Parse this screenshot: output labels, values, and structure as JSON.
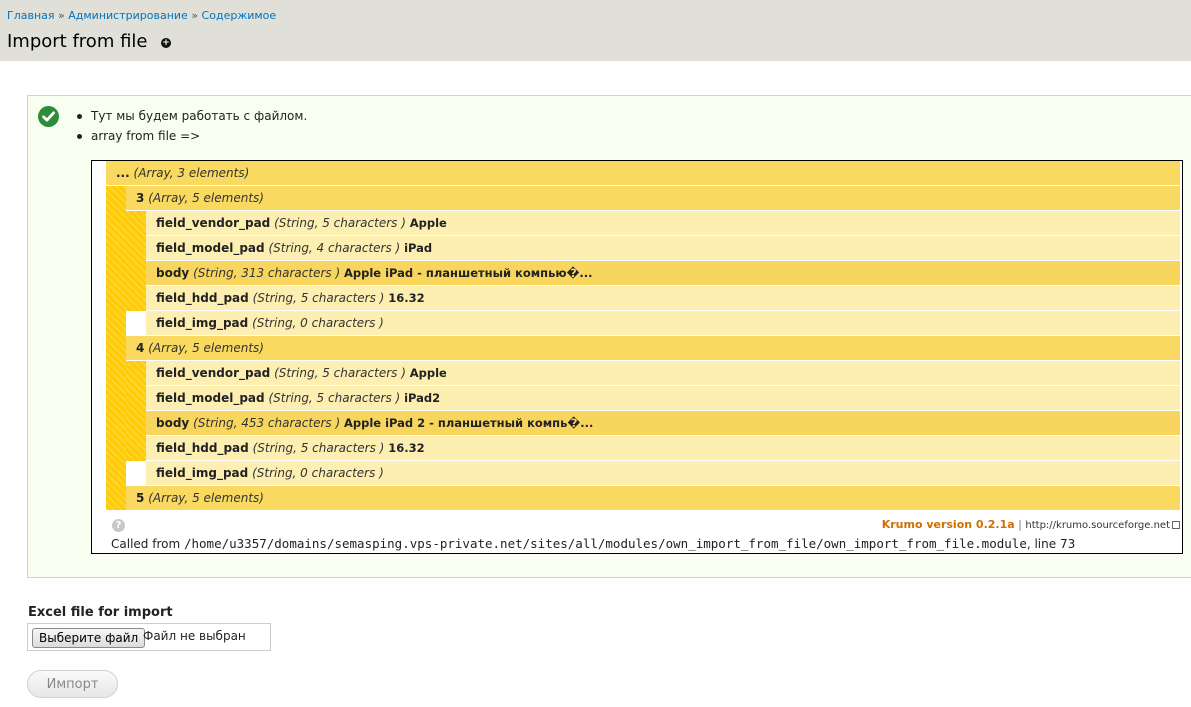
{
  "breadcrumb": {
    "items": [
      "Главная",
      "Администрирование",
      "Содержимое"
    ],
    "separator": "»"
  },
  "page": {
    "title": "Import from file",
    "shortcut_icon": "plus-circle-icon"
  },
  "messages": {
    "status_icon": "check-circle-icon",
    "items": [
      "Тут мы будем работать с файлом.",
      "array from file =>"
    ]
  },
  "krumo": {
    "root": {
      "name": "...",
      "type": "(Array, 3 elements)"
    },
    "groups": [
      {
        "name": "3",
        "type": "(Array, 5 elements)",
        "fields": [
          {
            "name": "field_vendor_pad",
            "type": "(String, 5 characters )",
            "value": "Apple"
          },
          {
            "name": "field_model_pad",
            "type": "(String, 4 characters )",
            "value": "iPad"
          },
          {
            "name": "body",
            "type": "(String, 313 characters )",
            "value": "Apple iPad - планшетный компью�..."
          },
          {
            "name": "field_hdd_pad",
            "type": "(String, 5 characters )",
            "value": "16.32"
          },
          {
            "name": "field_img_pad",
            "type": "(String, 0 characters )",
            "value": ""
          }
        ]
      },
      {
        "name": "4",
        "type": "(Array, 5 elements)",
        "fields": [
          {
            "name": "field_vendor_pad",
            "type": "(String, 5 characters )",
            "value": "Apple"
          },
          {
            "name": "field_model_pad",
            "type": "(String, 5 characters )",
            "value": "iPad2"
          },
          {
            "name": "body",
            "type": "(String, 453 characters )",
            "value": "Apple iPad 2 - планшетный компь�..."
          },
          {
            "name": "field_hdd_pad",
            "type": "(String, 5 characters )",
            "value": "16.32"
          },
          {
            "name": "field_img_pad",
            "type": "(String, 0 characters )",
            "value": ""
          }
        ]
      },
      {
        "name": "5",
        "type": "(Array, 5 elements)",
        "fields": []
      }
    ],
    "footer": {
      "help_icon": "help-icon",
      "version": "Krumo version 0.2.1a",
      "separator": "|",
      "link": "http://krumo.sourceforge.net",
      "called_from_label": "Called from",
      "called_from_path": "/home/u3357/domains/semasping.vps-private.net/sites/all/modules/own_import_from_file/own_import_from_file.module",
      "called_from_line": ", line 73"
    }
  },
  "form": {
    "file_label": "Excel file for import",
    "choose_button": "Выберите файл",
    "file_status": "Файл не выбран",
    "import_button": "Импорт"
  },
  "colors": {
    "header_bg": "#e0e0d8",
    "link": "#0074bd",
    "message_bg": "#f8fff0",
    "message_border": "#bbee77",
    "krumo_expanded": "#f9d95f",
    "krumo_leaf": "#fdefb1",
    "krumo_bar": "#ffcb05",
    "krumo_version": "#d06e00"
  }
}
